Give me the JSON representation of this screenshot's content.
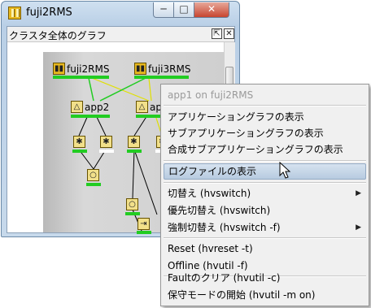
{
  "window": {
    "title": "fuji2RMS",
    "min_glyph": "─",
    "max_glyph": "□",
    "close_glyph": "✕"
  },
  "panel": {
    "title": "クラスタ全体のグラフ",
    "pin_glyph": "⇱",
    "close_glyph": "✕"
  },
  "graph": {
    "systems": [
      "fuji2RMS",
      "fuji3RMS"
    ],
    "apps": [
      "app2",
      "app1"
    ],
    "node_glyphs": {
      "system": "▮▮",
      "app": "△",
      "resource_star": "✱",
      "resource_circle": "○",
      "resource_arrow": "⇥"
    }
  },
  "menu": {
    "header": "app1 on fuji2RMS",
    "items": [
      "アプリケーショングラフの表示",
      "サブアプリケーショングラフの表示",
      "合成サブアプリケーショングラフの表示",
      "ログファイルの表示",
      "切替え (hvswitch)",
      "優先切替え (hvswitch)",
      "強制切替え (hvswitch -f)",
      "Reset (hvreset -t)",
      "Offline (hvutil -f)",
      "Faultのクリア (hvutil -c)",
      "保守モードの開始 (hvutil -m on)"
    ],
    "submenu_arrow": "▶",
    "highlighted_index": 3
  },
  "colors": {
    "state_online": "#22cc22",
    "state_offline": "#ffffff",
    "link_yellow": "#e0e000"
  }
}
